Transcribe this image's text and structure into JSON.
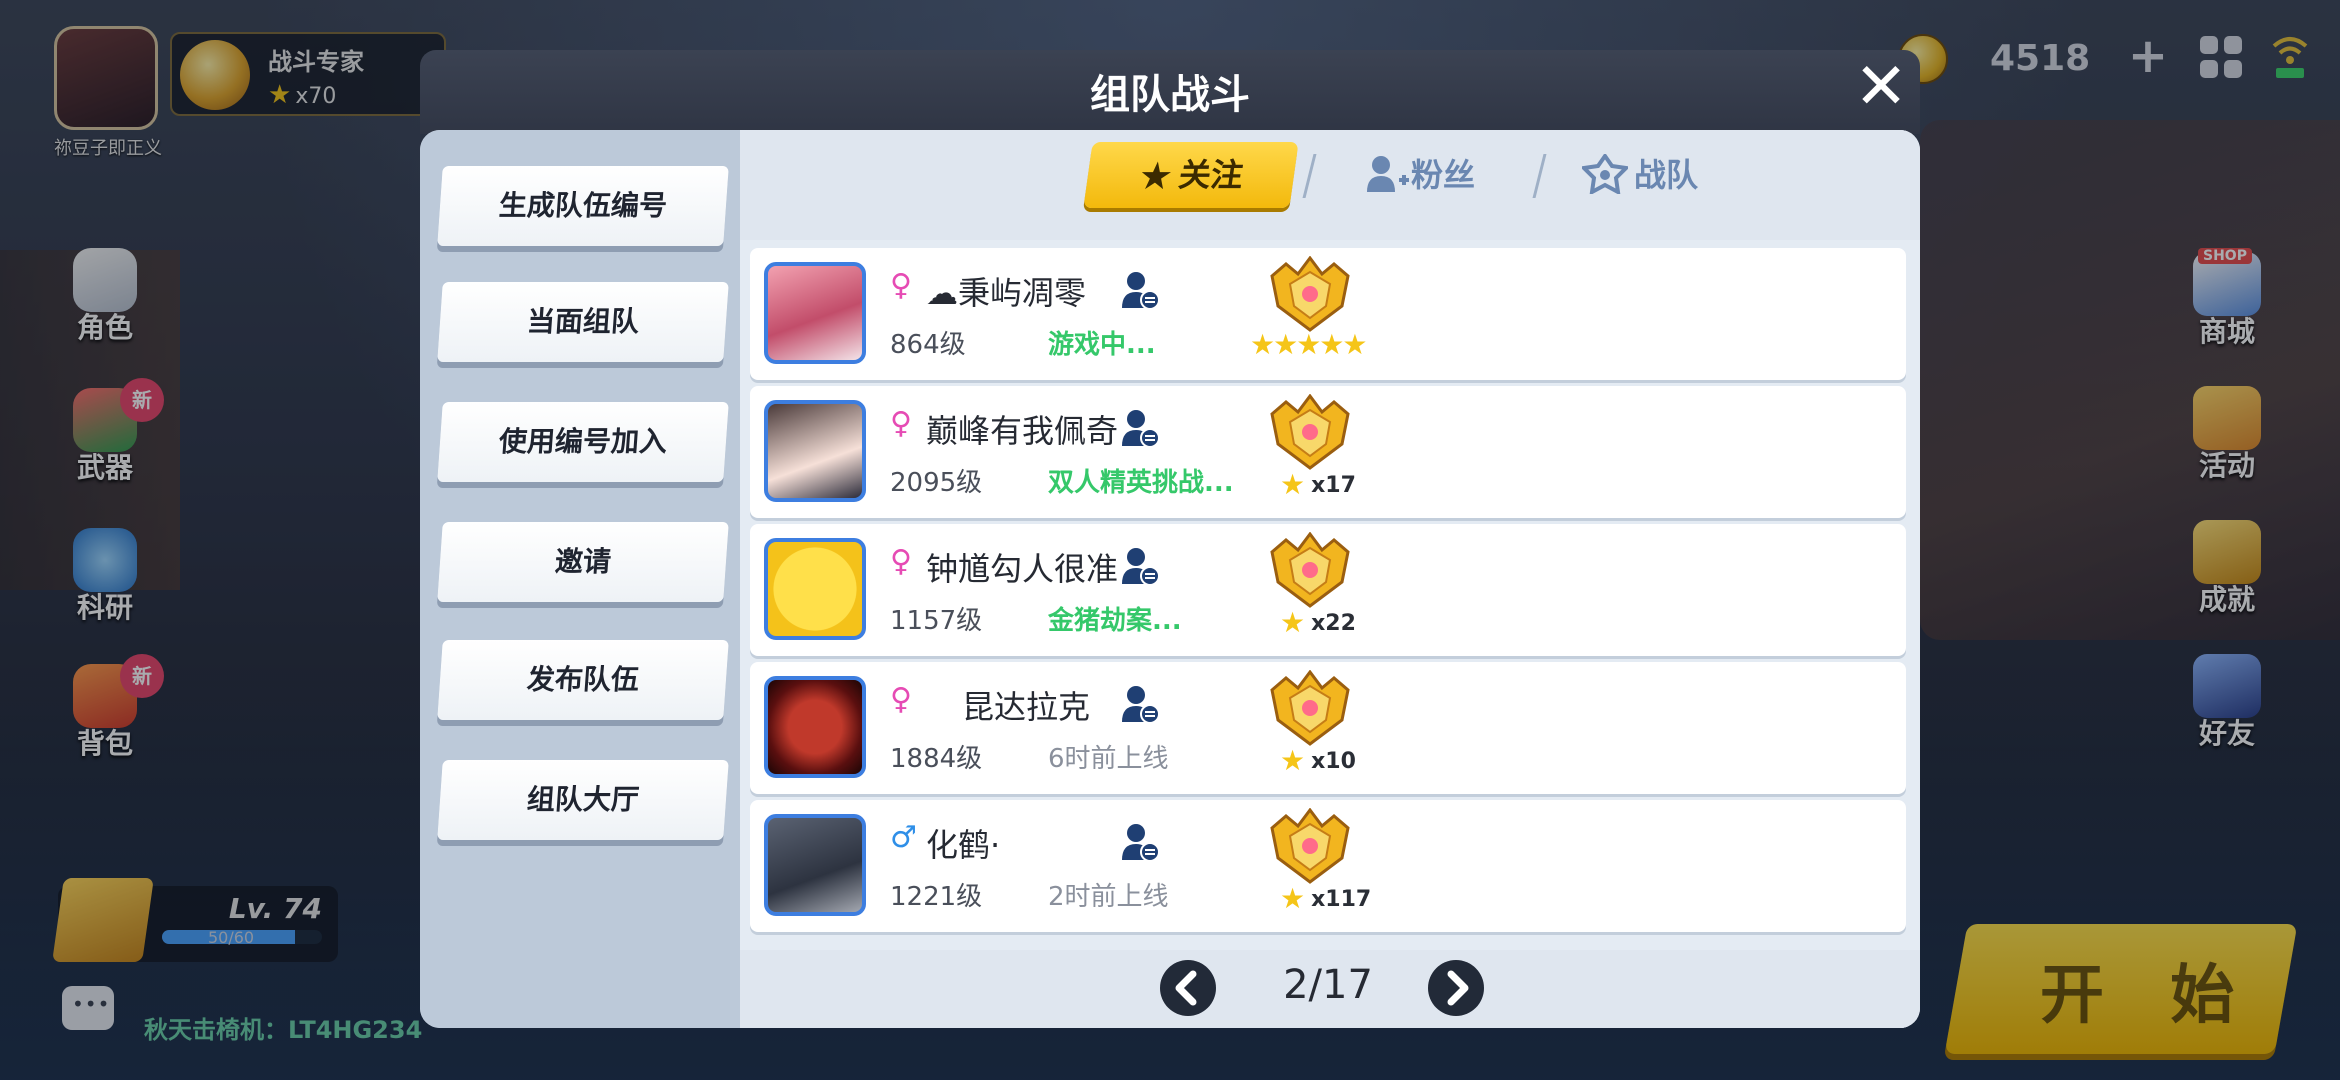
{
  "player": {
    "name": "祢豆子即正义",
    "rank_title": "战斗专家",
    "rank_stars": "x70"
  },
  "currency": {
    "coins": "4518"
  },
  "side_nav": [
    {
      "label": "角色",
      "badge": ""
    },
    {
      "label": "武器",
      "badge": "新"
    },
    {
      "label": "科研",
      "badge": ""
    },
    {
      "label": "背包",
      "badge": "新"
    }
  ],
  "right_nav": [
    {
      "label": "商城",
      "tag": "SHOP"
    },
    {
      "label": "活动"
    },
    {
      "label": "成就"
    },
    {
      "label": "好友"
    }
  ],
  "level": {
    "text": "Lv. 74",
    "progress_text": "50/60",
    "progress": 0.8333
  },
  "ticker": "秋天击椅机：LT4HG234",
  "start_label": "开 始",
  "modal": {
    "title": "组队战斗",
    "left_buttons": [
      "生成队伍编号",
      "当面组队",
      "使用编号加入",
      "邀请",
      "发布队伍",
      "组队大厅"
    ],
    "tabs": {
      "follow": "关注",
      "fans": "粉丝",
      "team": "战队"
    },
    "friends": [
      {
        "gender": "♀",
        "name": "☁秉屿凋零",
        "level": "864级",
        "status": "游戏中...",
        "online": true,
        "stars": "★★★★★",
        "star_count": ""
      },
      {
        "gender": "♀",
        "name": "巅峰有我佩奇",
        "level": "2095级",
        "status": "双人精英挑战...",
        "online": true,
        "stars": "",
        "star_count": "x17"
      },
      {
        "gender": "♀",
        "name": "钟馗勾人很准",
        "level": "1157级",
        "status": "金猪劫案...",
        "online": true,
        "stars": "",
        "star_count": "x22"
      },
      {
        "gender": "♀",
        "name": "昆达拉克",
        "level": "1884级",
        "status": "6时前上线",
        "online": false,
        "stars": "",
        "star_count": "x10"
      },
      {
        "gender": "♂",
        "name": "化鹤·",
        "level": "1221级",
        "status": "2时前上线",
        "online": false,
        "stars": "",
        "star_count": "x117"
      }
    ],
    "pager": "2/17"
  },
  "colors": {
    "accent_yellow": "#f3b90c",
    "online_green": "#35c86a",
    "female_pink": "#e64bb4",
    "male_blue": "#2f8fe8",
    "avatar_border": "#3d7ee0"
  }
}
